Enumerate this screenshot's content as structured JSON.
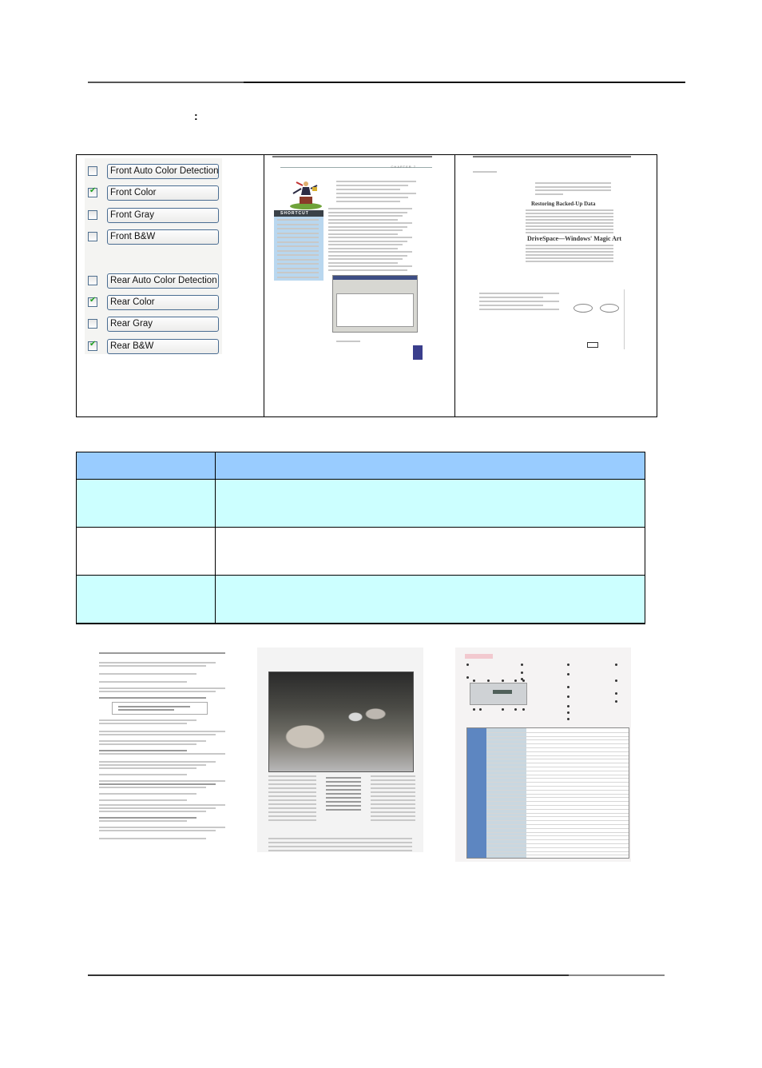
{
  "page": {
    "colon_marker": ":"
  },
  "example_panels": {
    "checkbox_options": [
      {
        "label": "Front Auto Color Detection",
        "checked": false
      },
      {
        "label": "Front Color",
        "checked": true
      },
      {
        "label": "Front Gray",
        "checked": false
      },
      {
        "label": "Front B&W",
        "checked": false
      },
      {
        "label": "Rear Auto Color Detection",
        "checked": false
      },
      {
        "label": "Rear Color",
        "checked": true
      },
      {
        "label": "Rear Gray",
        "checked": false
      },
      {
        "label": "Rear B&W",
        "checked": true
      }
    ],
    "shortcut_page": {
      "chapter_label": "CHAPTER 7",
      "sidebar_label": "SHORTCUT"
    },
    "backup_page": {
      "heading_1": "Restoring Backed-Up Data",
      "heading_2": "DriveSpace—Windows' Magic Art"
    }
  },
  "table": {
    "header": [
      "",
      ""
    ],
    "rows": [
      {
        "cells": [
          "",
          ""
        ],
        "style": "alt"
      },
      {
        "cells": [
          "",
          ""
        ],
        "style": "plain"
      },
      {
        "cells": [
          "",
          ""
        ],
        "style": "alt"
      }
    ],
    "colors": {
      "header_bg": "#99ccff",
      "alt_row_bg": "#ccffff",
      "plain_row_bg": "#ffffff"
    }
  },
  "sample_images": [
    {
      "name": "text-document-sample"
    },
    {
      "name": "photo-article-sample"
    },
    {
      "name": "spec-sheet-sample"
    }
  ]
}
